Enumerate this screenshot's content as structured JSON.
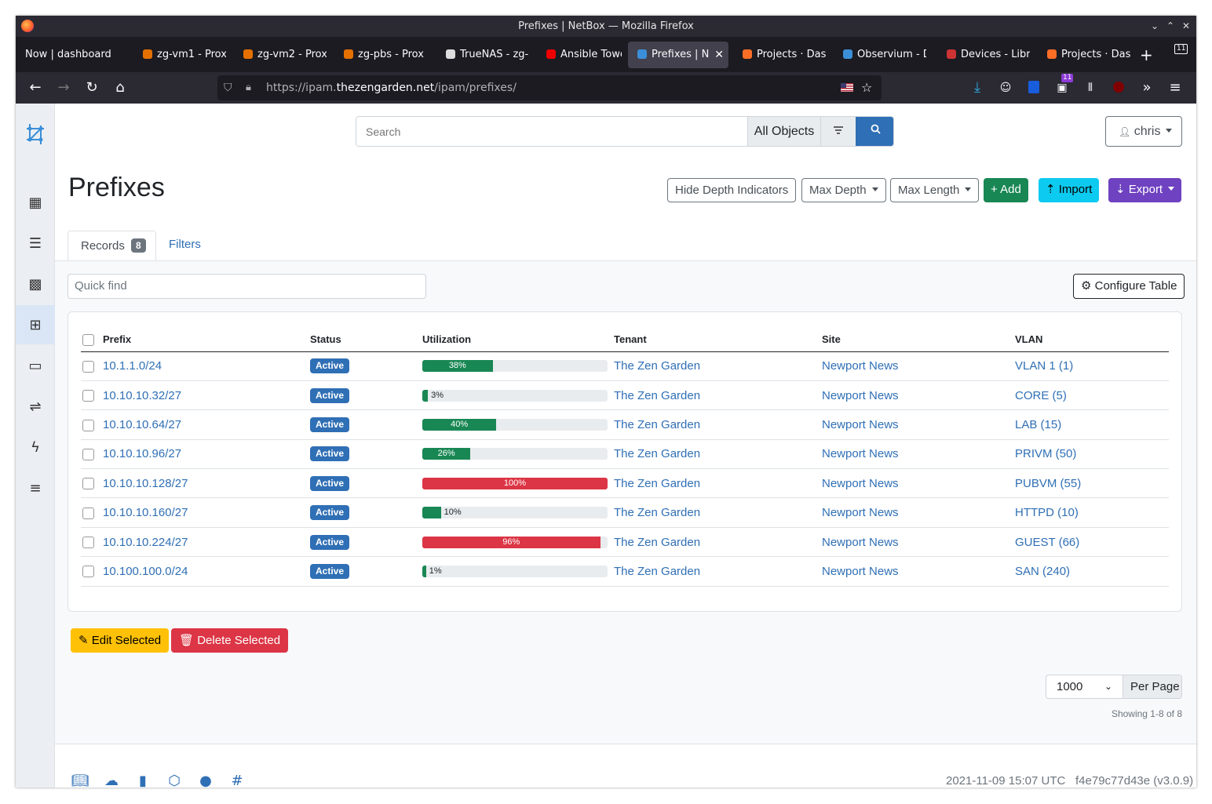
{
  "window": {
    "title": "Prefixes | NetBox — Mozilla Firefox"
  },
  "tabs": [
    {
      "label": "Now | dashboard",
      "icon": "now-icon"
    },
    {
      "label": "zg-vm1 - Prox",
      "icon": "proxmox-icon"
    },
    {
      "label": "zg-vm2 - Prox",
      "icon": "proxmox-icon"
    },
    {
      "label": "zg-pbs - Prox",
      "icon": "proxmox-icon"
    },
    {
      "label": "TrueNAS - zg-",
      "icon": "truenas-icon"
    },
    {
      "label": "Ansible Tower",
      "icon": "redhat-icon"
    },
    {
      "label": "Prefixes | N",
      "icon": "netbox-icon",
      "active": true
    },
    {
      "label": "Projects · Das",
      "icon": "gitlab-icon"
    },
    {
      "label": "Observium - D",
      "icon": "observium-icon"
    },
    {
      "label": "Devices - Libr",
      "icon": "librenms-icon"
    },
    {
      "label": "Projects · Das",
      "icon": "gitlab-icon"
    }
  ],
  "tab_count": "11",
  "url": {
    "prefix": "https://ipam.",
    "host": "thezengarden.net",
    "path": "/ipam/prefixes/"
  },
  "ext_badge": "11",
  "search": {
    "placeholder": "Search",
    "scope": "All Objects"
  },
  "user": {
    "name": "chris"
  },
  "page_title": "Prefixes",
  "toolbar": {
    "hide_depth": "Hide Depth Indicators",
    "max_depth": "Max Depth",
    "max_length": "Max Length",
    "add": "Add",
    "import": "Import",
    "export": "Export"
  },
  "records_tab": {
    "label": "Records",
    "count": "8"
  },
  "filters_tab": {
    "label": "Filters"
  },
  "quick_find": {
    "placeholder": "Quick find"
  },
  "configure_table": "Configure Table",
  "table": {
    "headers": {
      "prefix": "Prefix",
      "status": "Status",
      "utilization": "Utilization",
      "tenant": "Tenant",
      "site": "Site",
      "vlan": "VLAN"
    },
    "rows": [
      {
        "prefix": "10.1.1.0/24",
        "status": "Active",
        "util": 38,
        "util_label": "38%",
        "tenant": "The Zen Garden",
        "site": "Newport News",
        "vlan": "VLAN 1 (1)"
      },
      {
        "prefix": "10.10.10.32/27",
        "status": "Active",
        "util": 3,
        "util_label": "3%",
        "tenant": "The Zen Garden",
        "site": "Newport News",
        "vlan": "CORE (5)"
      },
      {
        "prefix": "10.10.10.64/27",
        "status": "Active",
        "util": 40,
        "util_label": "40%",
        "tenant": "The Zen Garden",
        "site": "Newport News",
        "vlan": "LAB (15)"
      },
      {
        "prefix": "10.10.10.96/27",
        "status": "Active",
        "util": 26,
        "util_label": "26%",
        "tenant": "The Zen Garden",
        "site": "Newport News",
        "vlan": "PRIVM (50)"
      },
      {
        "prefix": "10.10.10.128/27",
        "status": "Active",
        "util": 100,
        "util_label": "100%",
        "tenant": "The Zen Garden",
        "site": "Newport News",
        "vlan": "PUBVM (55)"
      },
      {
        "prefix": "10.10.10.160/27",
        "status": "Active",
        "util": 10,
        "util_label": "10%",
        "tenant": "The Zen Garden",
        "site": "Newport News",
        "vlan": "HTTPD (10)"
      },
      {
        "prefix": "10.10.10.224/27",
        "status": "Active",
        "util": 96,
        "util_label": "96%",
        "tenant": "The Zen Garden",
        "site": "Newport News",
        "vlan": "GUEST (66)"
      },
      {
        "prefix": "10.100.100.0/24",
        "status": "Active",
        "util": 1,
        "util_label": "1%",
        "tenant": "The Zen Garden",
        "site": "Newport News",
        "vlan": "SAN (240)"
      }
    ]
  },
  "actions": {
    "edit": "Edit Selected",
    "delete": "Delete Selected"
  },
  "pagination": {
    "per_page_value": "1000",
    "per_page_label": "Per Page",
    "showing": "Showing 1-8 of 8"
  },
  "footer": {
    "timestamp": "2021-11-09 15:07 UTC",
    "version": "f4e79c77d43e (v3.0.9)"
  },
  "colors": {
    "primary": "#2f6fb5",
    "success": "#198754",
    "danger": "#dc3545",
    "warning": "#ffc107",
    "info": "#0dcaf0",
    "purple": "#6f42c1"
  }
}
